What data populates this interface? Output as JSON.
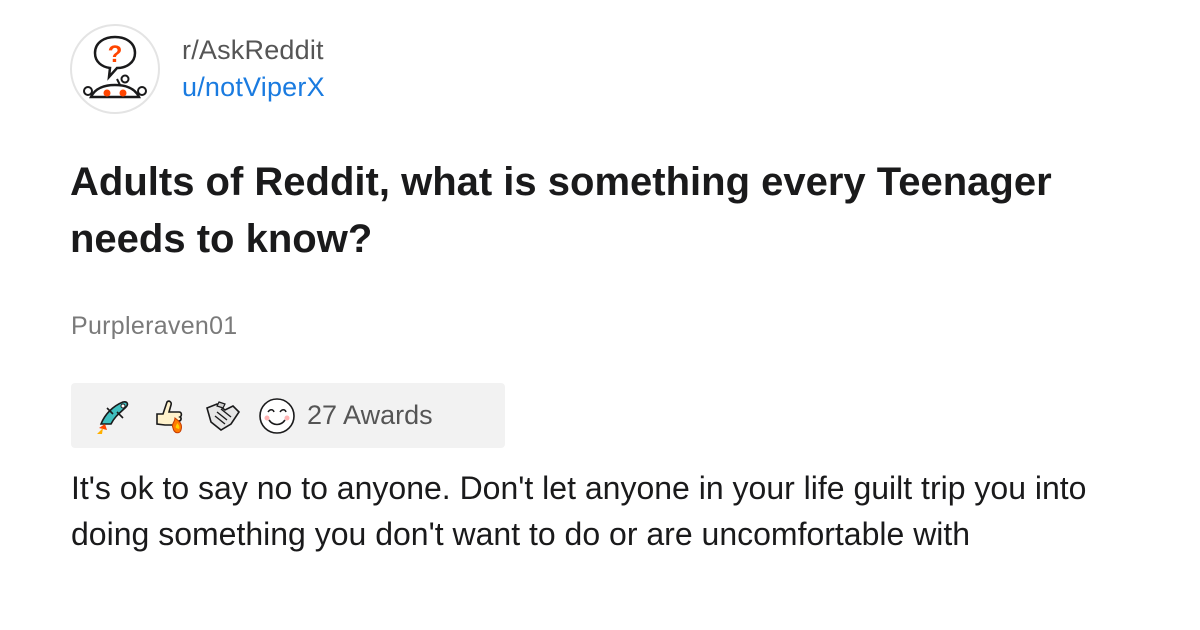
{
  "post": {
    "subreddit": "r/AskReddit",
    "author": "u/notViperX",
    "title": "Adults of Reddit, what is something every Teenager needs to know?"
  },
  "comment": {
    "username": "Purpleraven01",
    "awards": {
      "icons": [
        "rocket-hand-award-icon",
        "thumbs-up-fire-award-icon",
        "handshake-award-icon",
        "wholesome-face-award-icon"
      ],
      "label": "27 Awards"
    },
    "text": "It's ok to say no to anyone. Don't let anyone in your life guilt trip you into doing something you don't want to do or are uncomfortable with"
  },
  "colors": {
    "link_blue": "#1a7be0",
    "text_dark": "#1a1a1b",
    "text_muted": "#7a7a7a",
    "award_bar_bg": "#f2f2f2",
    "snoo_orange": "#ff4500"
  }
}
